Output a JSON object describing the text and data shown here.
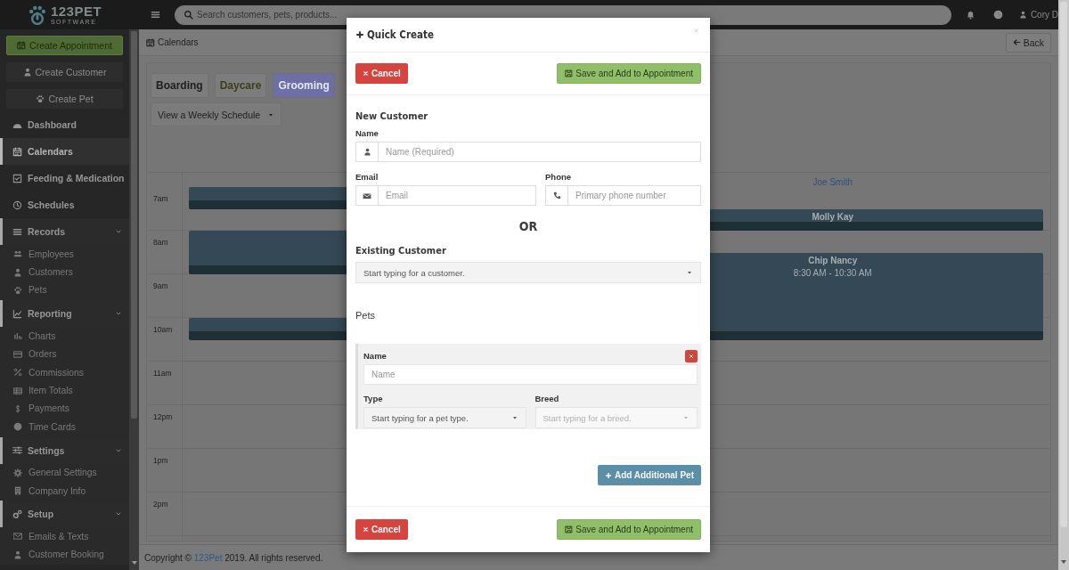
{
  "topbar": {
    "brand": "123PET",
    "tagline": "SOFTWARE",
    "search": {
      "placeholder": "Search customers, pets, products..."
    },
    "user": "Cory D"
  },
  "sidebar": {
    "actions": [
      {
        "label": "Create Appointment",
        "kind": "primary"
      },
      {
        "label": "Create Customer",
        "kind": "plain"
      },
      {
        "label": "Create Pet",
        "kind": "plain"
      }
    ],
    "items": [
      {
        "label": "Dashboard",
        "selected": false
      },
      {
        "label": "Calendars",
        "selected": true
      },
      {
        "label": "Feeding & Medication",
        "selected": false
      },
      {
        "label": "Schedules",
        "selected": false
      },
      {
        "label": "Records",
        "selected": false,
        "expanded": true,
        "children": [
          {
            "label": "Employees",
            "selected": false
          },
          {
            "label": "Customers",
            "selected": false
          },
          {
            "label": "Pets",
            "selected": false
          }
        ]
      },
      {
        "label": "Reporting",
        "selected": false,
        "expanded": true,
        "children": [
          {
            "label": "Charts",
            "selected": false
          },
          {
            "label": "Orders",
            "selected": false
          },
          {
            "label": "Commissions",
            "selected": false
          },
          {
            "label": "Item Totals",
            "selected": false
          },
          {
            "label": "Payments",
            "selected": false
          },
          {
            "label": "Time Cards",
            "selected": false
          }
        ]
      },
      {
        "label": "Settings",
        "selected": false,
        "expanded": true,
        "children": [
          {
            "label": "General Settings",
            "selected": false
          },
          {
            "label": "Company Info",
            "selected": false
          }
        ]
      },
      {
        "label": "Setup",
        "selected": false,
        "expanded": true,
        "children": [
          {
            "label": "Emails & Texts",
            "selected": false
          },
          {
            "label": "Customer Booking",
            "selected": false
          }
        ]
      }
    ]
  },
  "page": {
    "title": "Calendars",
    "back": "Back"
  },
  "calendar": {
    "tabs": [
      {
        "label": "Boarding",
        "selected": false,
        "color": "#1e1e1e"
      },
      {
        "label": "Daycare",
        "selected": false,
        "color": "#3e3e1c"
      },
      {
        "label": "Grooming",
        "selected": true,
        "color": "#6e6fa6"
      }
    ],
    "view_select": "View a Weekly Schedule",
    "hours": [
      "7am",
      "8am",
      "9am",
      "10am",
      "11am",
      "12pm",
      "1pm",
      "2pm"
    ],
    "columns": [
      {
        "slots": [
          {
            "kind": "start"
          },
          {
            "kind": "free"
          },
          {
            "kind": "start"
          },
          {
            "kind": "cont"
          },
          {
            "kind": "free"
          },
          {
            "kind": "free"
          },
          {
            "kind": "start"
          }
        ]
      },
      {
        "header": "Joe Smith",
        "slots": [
          {
            "kind": "free"
          },
          {
            "kind": "start",
            "title": "Molly Kay"
          },
          {
            "kind": "free"
          },
          {
            "kind": "start",
            "title": "Chip Nancy",
            "time": "8:30 AM - 10:30 AM"
          },
          {
            "kind": "cont"
          },
          {
            "kind": "cont"
          },
          {
            "kind": "cont"
          }
        ]
      }
    ]
  },
  "footer": {
    "prefix": "Copyright © ",
    "link": "123Pet",
    "suffix": " 2019. All rights reserved."
  },
  "modal": {
    "title": "Quick Create",
    "cancel": "Cancel",
    "save": "Save and Add to Appointment",
    "new_customer": {
      "heading": "New Customer",
      "name_label": "Name",
      "name_placeholder": "Name (Required)",
      "email_label": "Email",
      "email_placeholder": "Email",
      "phone_label": "Phone",
      "phone_placeholder": "Primary phone number"
    },
    "or": "OR",
    "existing_customer": {
      "heading": "Existing Customer",
      "placeholder": "Start typing for a customer."
    },
    "pets": {
      "heading": "Pets",
      "items": [
        {
          "name_label": "Name",
          "name_placeholder": "Name",
          "type_label": "Type",
          "type_placeholder": "Start typing for a pet type.",
          "breed_label": "Breed",
          "breed_placeholder": "Start typing for a breed.",
          "breed_disabled": true
        }
      ],
      "add": "Add Additional Pet"
    },
    "footer_cancel": "Cancel",
    "footer_save": "Save and Add to Appointment"
  }
}
